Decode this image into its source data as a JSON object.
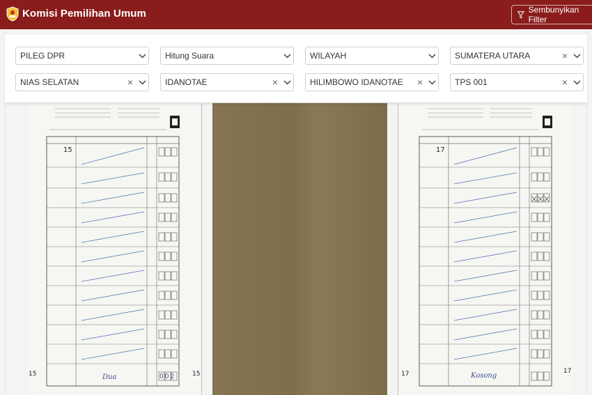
{
  "header": {
    "title": "Komisi Pemilihan Umum",
    "toggle_filter_label": "Sembunyikan Filter",
    "brand_color": "#8a1c1c"
  },
  "filters": [
    {
      "value": "PILEG DPR",
      "clearable": false
    },
    {
      "value": "Hitung Suara",
      "clearable": false
    },
    {
      "value": "WILAYAH",
      "clearable": false
    },
    {
      "value": "SUMATERA UTARA",
      "clearable": true
    },
    {
      "value": "NIAS SELATAN",
      "clearable": true
    },
    {
      "value": "IDANOTAE",
      "clearable": true
    },
    {
      "value": "HILIMBOWO IDANOTAE",
      "clearable": true
    },
    {
      "value": "TPS 001",
      "clearable": true
    }
  ],
  "documents": [
    {
      "page_number": "15",
      "party_number": "15",
      "handwritten_note": "Dua",
      "tally": "002"
    },
    {
      "page_number": "",
      "party_number": "",
      "handwritten_note": "",
      "tally": ""
    },
    {
      "page_number": "17",
      "party_number": "17",
      "handwritten_note": "Kosong",
      "tally": ""
    }
  ]
}
